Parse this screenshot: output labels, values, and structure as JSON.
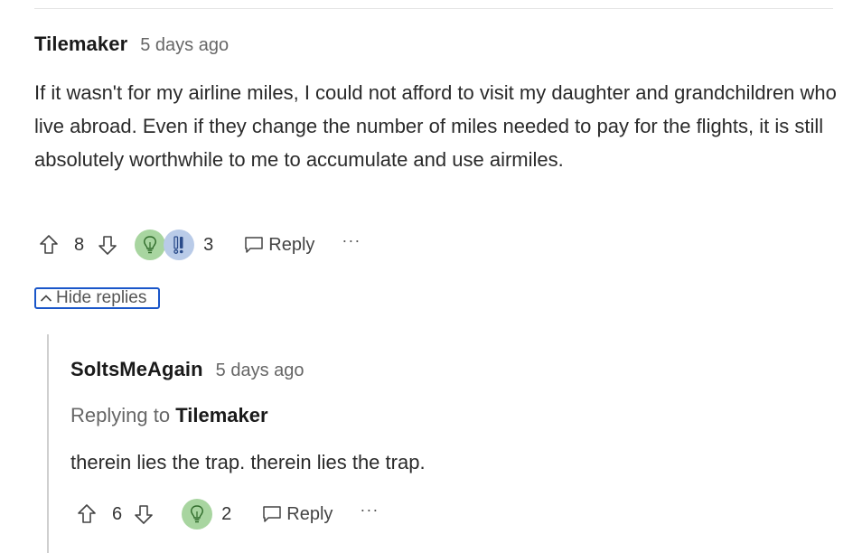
{
  "comment": {
    "author": "Tilemaker",
    "timestamp": "5 days ago",
    "body": "If it wasn't for my airline miles, I could not afford to visit my daughter and grandchildren who live abroad. Even if they change the number of miles needed to pay for the flights, it is still absolutely worthwhile to me to accumulate and use airmiles.",
    "upvotes": "8",
    "reactions_count": "3",
    "reply_label": "Reply",
    "more_label": "···",
    "reactions": [
      "lightbulb-icon",
      "exclamation-icon"
    ]
  },
  "hide_replies_label": "Hide replies",
  "reply": {
    "author": "SoltsMeAgain",
    "timestamp": "5 days ago",
    "replying_prefix": "Replying to",
    "replying_to": "Tilemaker",
    "body": "therein lies the trap. therein lies the trap.",
    "upvotes": "6",
    "reactions_count": "2",
    "reply_label": "Reply",
    "more_label": "···",
    "reactions": [
      "lightbulb-icon"
    ]
  },
  "colors": {
    "focus_outline": "#1a56c9",
    "reaction_green": "#a8d5a0",
    "reaction_blue": "#b9cbe8"
  }
}
